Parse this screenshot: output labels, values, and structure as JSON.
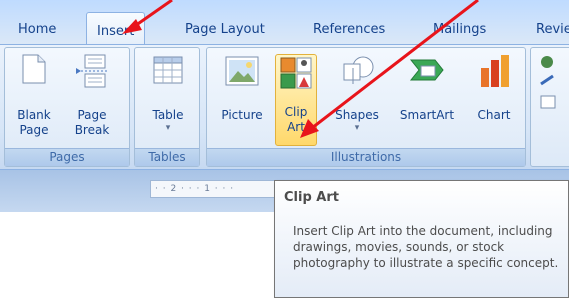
{
  "tabs": [
    {
      "label": "Home"
    },
    {
      "label": "Insert"
    },
    {
      "label": "Page Layout"
    },
    {
      "label": "References"
    },
    {
      "label": "Mailings"
    },
    {
      "label": "Revie"
    }
  ],
  "groups": {
    "pages": {
      "label": "Pages",
      "blank_page": "Blank\nPage",
      "page_break": "Page\nBreak"
    },
    "tables": {
      "label": "Tables",
      "table": "Table"
    },
    "illustrations": {
      "label": "Illustrations",
      "picture": "Picture",
      "clip_art": "Clip\nArt",
      "shapes": "Shapes",
      "smartart": "SmartArt",
      "chart": "Chart"
    }
  },
  "ruler": {
    "text": "· · 2 · · · 1 · · ·"
  },
  "tooltip": {
    "title": "Clip Art",
    "body": "Insert Clip Art into the document, including drawings, movies, sounds, or stock photography to illustrate a specific concept."
  },
  "colors": {
    "ribbon_text": "#15428b",
    "annotation_arrow": "#e8141b",
    "highlight": "#ffd86b"
  }
}
